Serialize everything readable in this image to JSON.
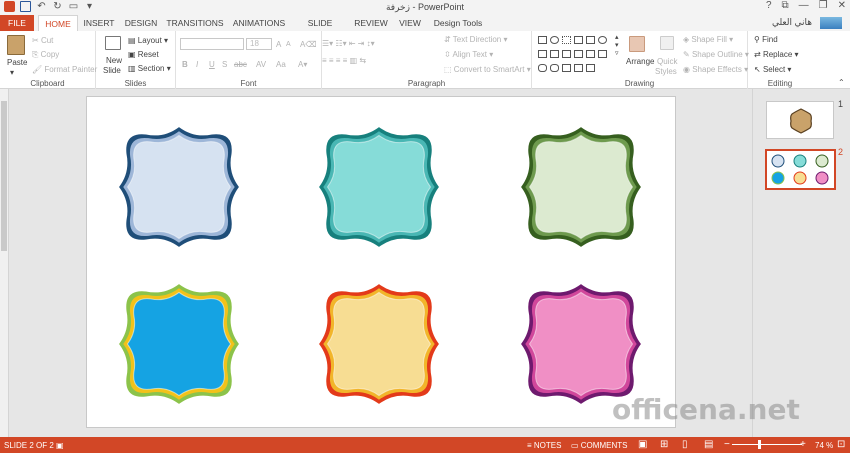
{
  "titlebar": {
    "title": "زخرفة - PowerPoint",
    "window_buttons": [
      "?",
      "⧉",
      "—",
      "❐",
      "✕"
    ]
  },
  "tabs": [
    {
      "label": "FILE"
    },
    {
      "label": "HOME"
    },
    {
      "label": "INSERT"
    },
    {
      "label": "DESIGN"
    },
    {
      "label": "TRANSITIONS"
    },
    {
      "label": "ANIMATIONS"
    },
    {
      "label": "SLIDE SHOW"
    },
    {
      "label": "REVIEW"
    },
    {
      "label": "VIEW"
    },
    {
      "label": "Design Tools"
    }
  ],
  "user": {
    "name": "هاني العلي"
  },
  "ribbon": {
    "clipboard": {
      "label": "Clipboard",
      "paste": "Paste",
      "cut": "Cut",
      "copy": "Copy",
      "format_painter": "Format Painter"
    },
    "slides": {
      "label": "Slides",
      "new_slide": "New",
      "new_slide2": "Slide",
      "layout": "Layout",
      "reset": "Reset",
      "section": "Section"
    },
    "font": {
      "label": "Font",
      "size": "18",
      "bold": "B",
      "italic": "I",
      "underline": "U",
      "strike": "S",
      "shadow": "abc",
      "spacing": "AV",
      "case": "Aa",
      "grow": "A",
      "shrink": "A"
    },
    "paragraph": {
      "label": "Paragraph",
      "text_direction": "Text Direction",
      "align_text": "Align Text",
      "smartart": "Convert to SmartArt"
    },
    "drawing": {
      "label": "Drawing",
      "arrange": "Arrange",
      "quick": "Quick",
      "styles": "Styles",
      "shape_fill": "Shape Fill",
      "shape_outline": "Shape Outline",
      "shape_effects": "Shape Effects"
    },
    "editing": {
      "label": "Editing",
      "find": "Find",
      "replace": "Replace",
      "select": "Select"
    }
  },
  "shapes": [
    {
      "fill": "#d6e2f1",
      "inner": "#9db6d8",
      "outer": "#1f4e79"
    },
    {
      "fill": "#86dcd8",
      "inner": "#49b7b4",
      "outer": "#17807d"
    },
    {
      "fill": "#dcead0",
      "inner": "#6e9a4e",
      "outer": "#365f1f"
    },
    {
      "fill": "#15a3e3",
      "inner": "#f2c21a",
      "outer": "#8cc34a"
    },
    {
      "fill": "#f7dd93",
      "inner": "#f2b52a",
      "outer": "#e33a1a"
    },
    {
      "fill": "#f08fc5",
      "inner": "#d1479b",
      "outer": "#6e1a6e"
    }
  ],
  "thumbnails": [
    {
      "number": "1"
    },
    {
      "number": "2"
    }
  ],
  "watermark": "officena.net",
  "status": {
    "slide": "SLIDE 2 OF 2",
    "notes": "NOTES",
    "comments": "COMMENTS",
    "zoom": "74 %"
  },
  "colors": {
    "accent": "#d24726"
  }
}
